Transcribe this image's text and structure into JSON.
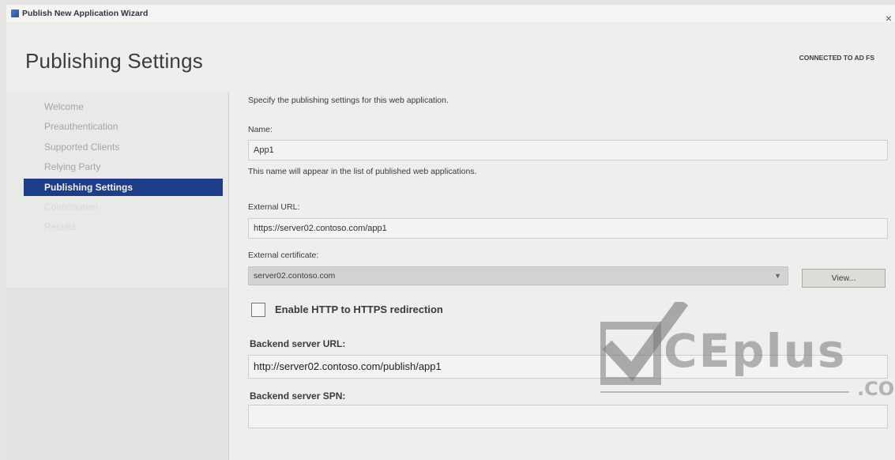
{
  "window": {
    "title": "Publish New Application Wizard",
    "close_glyph": "×"
  },
  "header": {
    "page_title": "Publishing Settings",
    "status": "CONNECTED TO AD FS"
  },
  "nav": {
    "items": [
      {
        "label": "Welcome",
        "state": "normal"
      },
      {
        "label": "Preauthentication",
        "state": "normal"
      },
      {
        "label": "Supported Clients",
        "state": "normal"
      },
      {
        "label": "Relying Party",
        "state": "normal"
      },
      {
        "label": "Publishing Settings",
        "state": "active"
      },
      {
        "label": "Confirmation",
        "state": "disabled"
      },
      {
        "label": "Results",
        "state": "disabled"
      }
    ]
  },
  "form": {
    "intro": "Specify the publishing settings for this web application.",
    "name_label": "Name:",
    "name_value": "App1",
    "name_hint": "This name will appear in the list of published web applications.",
    "external_url_label": "External URL:",
    "external_url_value": "https://server02.contoso.com/app1",
    "external_cert_label": "External certificate:",
    "external_cert_value": "server02.contoso.com",
    "view_button": "View...",
    "redirect_checkbox_label": "Enable HTTP to HTTPS redirection",
    "redirect_checked": false,
    "backend_url_label": "Backend server URL:",
    "backend_url_value": "http://server02.contoso.com/publish/app1",
    "backend_spn_label": "Backend server SPN:",
    "backend_spn_value": ""
  },
  "watermark": {
    "text": "CEplus",
    "suffix": ".CO"
  },
  "icons": {
    "app": "wizard-app-icon",
    "close": "close-icon",
    "dropdown": "chevron-down-icon",
    "checkbox": "checkbox-unchecked-icon"
  }
}
